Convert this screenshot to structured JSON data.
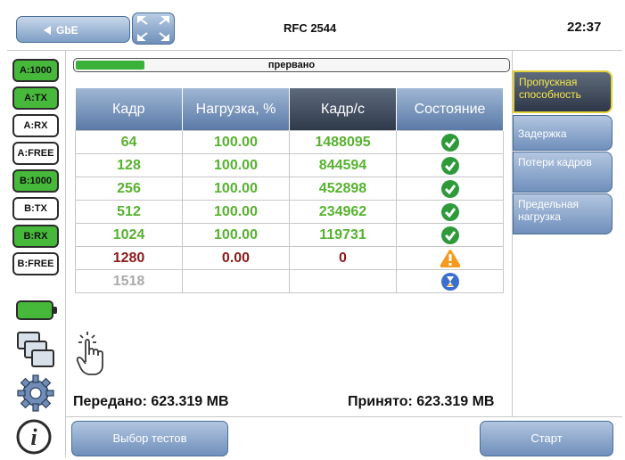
{
  "header": {
    "port_button": "GbE",
    "title": "RFC 2544",
    "clock": "22:37"
  },
  "ports": [
    {
      "label": "A:1000",
      "active": true
    },
    {
      "label": "A:TX",
      "active": true
    },
    {
      "label": "A:RX",
      "active": false
    },
    {
      "label": "A:FREE",
      "active": false
    },
    {
      "label": "B:1000",
      "active": true
    },
    {
      "label": "B:TX",
      "active": false
    },
    {
      "label": "B:RX",
      "active": true
    },
    {
      "label": "B:FREE",
      "active": false
    }
  ],
  "progress": {
    "status": "прервано",
    "fraction": 0.16
  },
  "table": {
    "columns": [
      "Кадр",
      "Нагрузка, %",
      "Кадр/с",
      "Состояние"
    ],
    "selected_column": 2,
    "rows": [
      {
        "frame": "64",
        "load": "100.00",
        "fps": "1488095",
        "state": "ok"
      },
      {
        "frame": "128",
        "load": "100.00",
        "fps": "844594",
        "state": "ok"
      },
      {
        "frame": "256",
        "load": "100.00",
        "fps": "452898",
        "state": "ok"
      },
      {
        "frame": "512",
        "load": "100.00",
        "fps": "234962",
        "state": "ok"
      },
      {
        "frame": "1024",
        "load": "100.00",
        "fps": "119731",
        "state": "ok"
      },
      {
        "frame": "1280",
        "load": "0.00",
        "fps": "0",
        "state": "warning"
      },
      {
        "frame": "1518",
        "load": "",
        "fps": "",
        "state": "pending"
      }
    ]
  },
  "totals": {
    "sent": "Передано: 623.319 MB",
    "received": "Принято: 623.319 MB"
  },
  "tabs": [
    {
      "label": "Пропускная способность",
      "active": true
    },
    {
      "label": "Задержка",
      "active": false
    },
    {
      "label": "Потери кадров",
      "active": false
    },
    {
      "label": "Предельная нагрузка",
      "active": false
    }
  ],
  "footer": {
    "select_tests": "Выбор тестов",
    "start": "Старт"
  },
  "colors": {
    "accent": "#6f8fbb",
    "ok": "#2e9a3a",
    "warning": "#f59a1c",
    "pending": "#3a6fd0",
    "port_active": "#46b83a"
  },
  "icons": [
    "back-arrow-icon",
    "maximize-icon",
    "battery-icon",
    "screens-icon",
    "gear-icon",
    "info-icon",
    "touch-hand-icon",
    "check-icon",
    "warning-icon",
    "hourglass-icon"
  ]
}
